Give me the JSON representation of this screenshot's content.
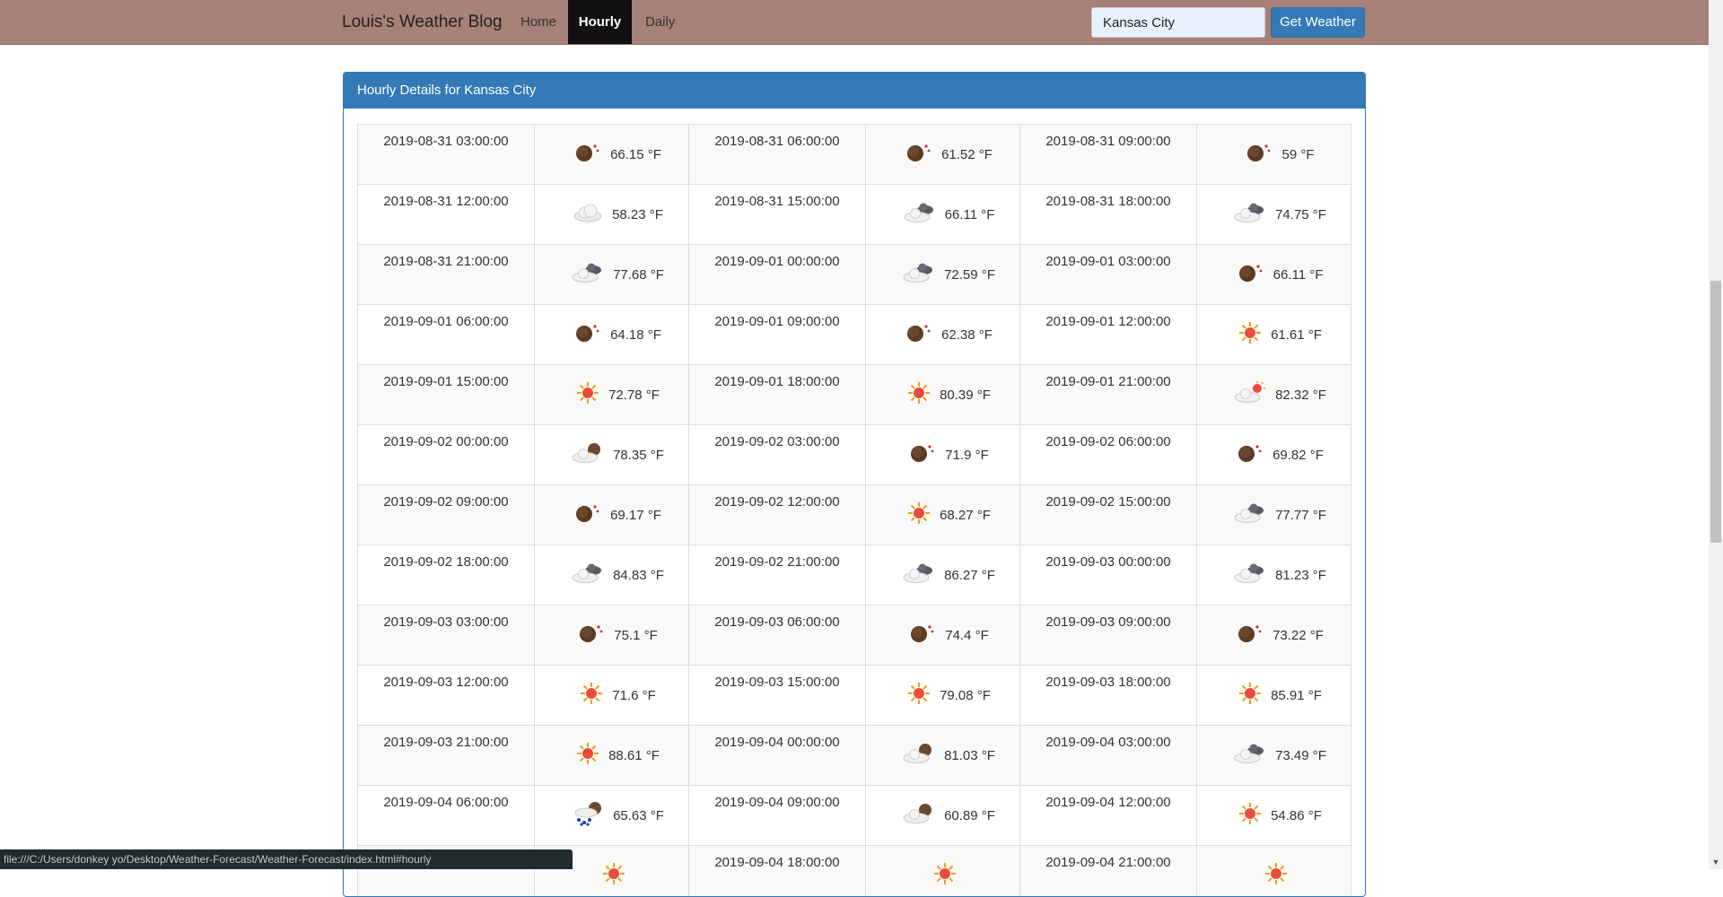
{
  "nav": {
    "brand": "Louis's Weather Blog",
    "links": [
      {
        "label": "Home"
      },
      {
        "label": "Hourly",
        "active": true
      },
      {
        "label": "Daily"
      }
    ],
    "search_value": "Kansas City",
    "button_label": "Get Weather"
  },
  "panel": {
    "title": "Hourly Details for Kansas City"
  },
  "forecast": [
    {
      "time": "2019-08-31 03:00:00",
      "icon": "night-clear-icon",
      "temp": "66.15 °F"
    },
    {
      "time": "2019-08-31 06:00:00",
      "icon": "night-clear-icon",
      "temp": "61.52 °F"
    },
    {
      "time": "2019-08-31 09:00:00",
      "icon": "night-clear-icon",
      "temp": "59 °F"
    },
    {
      "time": "2019-08-31 12:00:00",
      "icon": "cloud-icon",
      "temp": "58.23 °F"
    },
    {
      "time": "2019-08-31 15:00:00",
      "icon": "broken-clouds-icon",
      "temp": "66.11 °F"
    },
    {
      "time": "2019-08-31 18:00:00",
      "icon": "broken-clouds-icon",
      "temp": "74.75 °F"
    },
    {
      "time": "2019-08-31 21:00:00",
      "icon": "broken-clouds-icon",
      "temp": "77.68 °F"
    },
    {
      "time": "2019-09-01 00:00:00",
      "icon": "broken-clouds-icon",
      "temp": "72.59 °F"
    },
    {
      "time": "2019-09-01 03:00:00",
      "icon": "night-clear-icon",
      "temp": "66.11 °F"
    },
    {
      "time": "2019-09-01 06:00:00",
      "icon": "night-clear-icon",
      "temp": "64.18 °F"
    },
    {
      "time": "2019-09-01 09:00:00",
      "icon": "night-clear-icon",
      "temp": "62.38 °F"
    },
    {
      "time": "2019-09-01 12:00:00",
      "icon": "sun-icon",
      "temp": "61.61 °F"
    },
    {
      "time": "2019-09-01 15:00:00",
      "icon": "sun-icon",
      "temp": "72.78 °F"
    },
    {
      "time": "2019-09-01 18:00:00",
      "icon": "sun-icon",
      "temp": "80.39 °F"
    },
    {
      "time": "2019-09-01 21:00:00",
      "icon": "partly-sunny-icon",
      "temp": "82.32 °F"
    },
    {
      "time": "2019-09-02 00:00:00",
      "icon": "night-cloudy-icon",
      "temp": "78.35 °F"
    },
    {
      "time": "2019-09-02 03:00:00",
      "icon": "night-clear-icon",
      "temp": "71.9 °F"
    },
    {
      "time": "2019-09-02 06:00:00",
      "icon": "night-clear-icon",
      "temp": "69.82 °F"
    },
    {
      "time": "2019-09-02 09:00:00",
      "icon": "night-clear-icon",
      "temp": "69.17 °F"
    },
    {
      "time": "2019-09-02 12:00:00",
      "icon": "sun-icon",
      "temp": "68.27 °F"
    },
    {
      "time": "2019-09-02 15:00:00",
      "icon": "broken-clouds-icon",
      "temp": "77.77 °F"
    },
    {
      "time": "2019-09-02 18:00:00",
      "icon": "broken-clouds-icon",
      "temp": "84.83 °F"
    },
    {
      "time": "2019-09-02 21:00:00",
      "icon": "broken-clouds-icon",
      "temp": "86.27 °F"
    },
    {
      "time": "2019-09-03 00:00:00",
      "icon": "broken-clouds-icon",
      "temp": "81.23 °F"
    },
    {
      "time": "2019-09-03 03:00:00",
      "icon": "night-clear-icon",
      "temp": "75.1 °F"
    },
    {
      "time": "2019-09-03 06:00:00",
      "icon": "night-clear-icon",
      "temp": "74.4 °F"
    },
    {
      "time": "2019-09-03 09:00:00",
      "icon": "night-clear-icon",
      "temp": "73.22 °F"
    },
    {
      "time": "2019-09-03 12:00:00",
      "icon": "sun-icon",
      "temp": "71.6 °F"
    },
    {
      "time": "2019-09-03 15:00:00",
      "icon": "sun-icon",
      "temp": "79.08 °F"
    },
    {
      "time": "2019-09-03 18:00:00",
      "icon": "sun-icon",
      "temp": "85.91 °F"
    },
    {
      "time": "2019-09-03 21:00:00",
      "icon": "sun-icon",
      "temp": "88.61 °F"
    },
    {
      "time": "2019-09-04 00:00:00",
      "icon": "night-cloudy-icon",
      "temp": "81.03 °F"
    },
    {
      "time": "2019-09-04 03:00:00",
      "icon": "broken-clouds-icon",
      "temp": "73.49 °F"
    },
    {
      "time": "2019-09-04 06:00:00",
      "icon": "night-rain-icon",
      "temp": "65.63 °F"
    },
    {
      "time": "2019-09-04 09:00:00",
      "icon": "night-cloudy-icon",
      "temp": "60.89 °F"
    },
    {
      "time": "2019-09-04 12:00:00",
      "icon": "sun-icon",
      "temp": "54.86 °F"
    },
    {
      "time": "",
      "icon": "sun-icon",
      "temp": ""
    },
    {
      "time": "2019-09-04 18:00:00",
      "icon": "sun-icon",
      "temp": ""
    },
    {
      "time": "2019-09-04 21:00:00",
      "icon": "sun-icon",
      "temp": ""
    }
  ],
  "statusbar": {
    "url": "file:///C:/Users/donkey yo/Desktop/Weather-Forecast/Weather-Forecast/index.html#hourly"
  },
  "colors": {
    "navbar": "#a78177",
    "primary": "#337ab7",
    "active_nav": "#111111"
  }
}
